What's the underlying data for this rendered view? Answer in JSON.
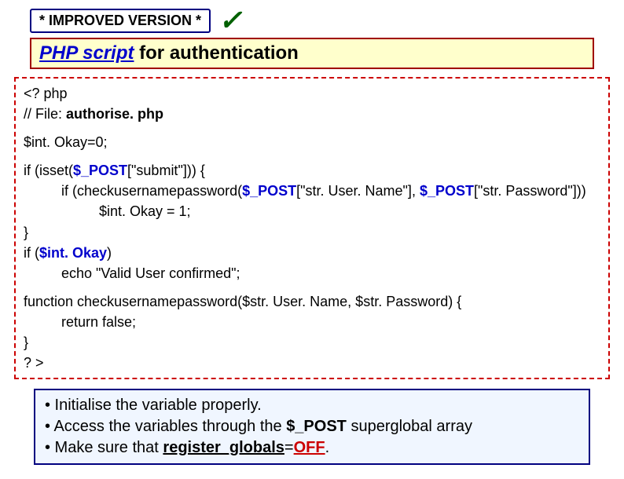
{
  "badge": "* IMPROVED VERSION *",
  "checkmark": "✓",
  "title": {
    "emph": "PHP script",
    "rest": " for authentication"
  },
  "code": {
    "open": "<? php",
    "fileComment": "// File: ",
    "fileName": "authorise. php",
    "init": "$int. Okay=0;",
    "ifIsset1": "if (isset(",
    "post": "$_POST",
    "ifIsset2": "[\"submit\"])) {",
    "check1": "if (checkusernamepassword(",
    "check2": "[\"str. User. Name\"], ",
    "check3": "[\"str. Password\"]))",
    "setOkay": "$int. Okay = 1;",
    "braceClose": "}",
    "ifOkay1": "if (",
    "intOkay": "$int. Okay",
    "ifOkay2": ")",
    "echo": "echo \"Valid User confirmed\";",
    "fn": "function checkusernamepassword($str. User. Name, $str. Password) {",
    "ret": "return false;",
    "close": "? >"
  },
  "notes": {
    "b1": "• Initialise the variable properly.",
    "b2a": "• Access the variables through the ",
    "b2b": "$_POST",
    "b2c": " superglobal array",
    "b3a": "• Make sure that ",
    "rg": "register_globals",
    "eq": "=",
    "off": "OFF",
    "b3b": "."
  }
}
